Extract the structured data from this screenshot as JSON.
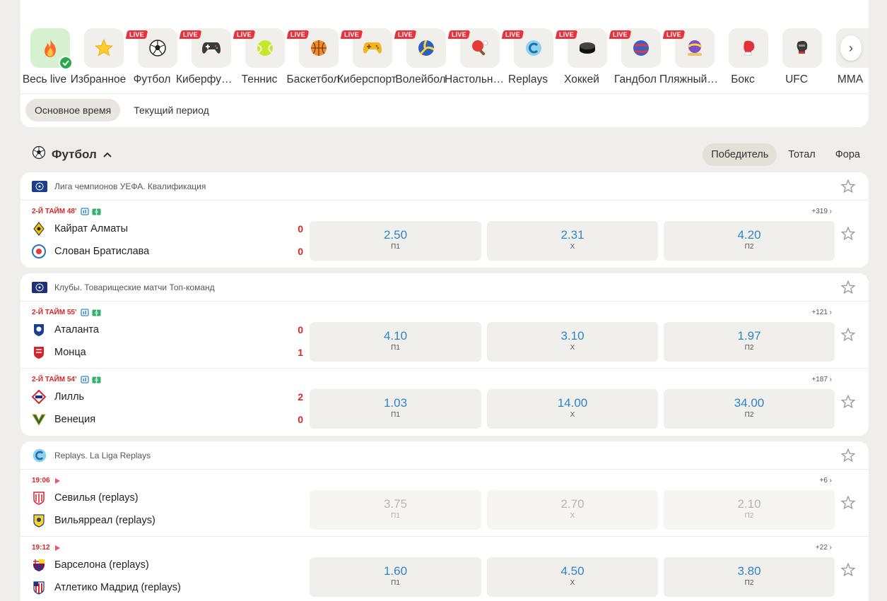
{
  "sports": [
    {
      "label": "Весь live",
      "icon": "fire-icon",
      "live": false,
      "active": true
    },
    {
      "label": "Избранное",
      "icon": "star-icon",
      "live": false
    },
    {
      "label": "Футбол",
      "icon": "soccer-ball-icon",
      "live": true
    },
    {
      "label": "Киберфутбол",
      "icon": "gamepad-icon",
      "live": true
    },
    {
      "label": "Теннис",
      "icon": "tennis-ball-icon",
      "live": true
    },
    {
      "label": "Баскетбол",
      "icon": "basketball-icon",
      "live": true
    },
    {
      "label": "Киберспорт",
      "icon": "joystick-icon",
      "live": true
    },
    {
      "label": "Волейбол",
      "icon": "volleyball-icon",
      "live": true
    },
    {
      "label": "Настольный теннис",
      "icon": "ping-pong-icon",
      "live": true
    },
    {
      "label": "Replays",
      "icon": "replays-icon",
      "live": true
    },
    {
      "label": "Хоккей",
      "icon": "hockey-puck-icon",
      "live": true
    },
    {
      "label": "Гандбол",
      "icon": "handball-icon",
      "live": true
    },
    {
      "label": "Пляжный волейбол",
      "icon": "beach-volleyball-icon",
      "live": true
    },
    {
      "label": "Бокс",
      "icon": "boxing-glove-icon",
      "live": false
    },
    {
      "label": "UFC",
      "icon": "mma-glove-icon",
      "live": false
    },
    {
      "label": "MMA",
      "icon": "mma-icon",
      "live": false
    }
  ],
  "live_label": "LIVE",
  "period_tabs": [
    "Основное время",
    "Текущий период"
  ],
  "section": {
    "title": "Футбол"
  },
  "market_tabs": [
    "Победитель",
    "Тотал",
    "Фора"
  ],
  "leagues": [
    {
      "name": "Лига чемпионов УЕФА. Квалификация",
      "matches": [
        {
          "time": "2-Й ТАЙМ 48'",
          "more": "+319 ›",
          "home": "Кайрат Алматы",
          "away": "Слован Братислава",
          "home_score": "0",
          "away_score": "0",
          "odds": [
            {
              "val": "2.50",
              "label": "П1"
            },
            {
              "val": "2.31",
              "label": "Х"
            },
            {
              "val": "4.20",
              "label": "П2"
            }
          ]
        }
      ]
    },
    {
      "name": "Клубы. Товарищеские матчи Топ-команд",
      "matches": [
        {
          "time": "2-Й ТАЙМ 55'",
          "more": "+121 ›",
          "home": "Аталанта",
          "away": "Монца",
          "home_score": "0",
          "away_score": "1",
          "odds": [
            {
              "val": "4.10",
              "label": "П1"
            },
            {
              "val": "3.10",
              "label": "Х"
            },
            {
              "val": "1.97",
              "label": "П2"
            }
          ]
        },
        {
          "time": "2-Й ТАЙМ 54'",
          "more": "+187 ›",
          "home": "Лилль",
          "away": "Венеция",
          "home_score": "2",
          "away_score": "0",
          "odds": [
            {
              "val": "1.03",
              "label": "П1"
            },
            {
              "val": "14.00",
              "label": "Х"
            },
            {
              "val": "34.00",
              "label": "П2"
            }
          ]
        }
      ]
    },
    {
      "name": "Replays. La Liga Replays",
      "matches": [
        {
          "time": "19:06",
          "more": "+6 ›",
          "home": "Севилья (replays)",
          "away": "Вильярреал (replays)",
          "home_score": "",
          "away_score": "",
          "odds": [
            {
              "val": "3.75",
              "label": "П1"
            },
            {
              "val": "2.70",
              "label": "Х"
            },
            {
              "val": "2.10",
              "label": "П2"
            }
          ]
        },
        {
          "time": "19:12",
          "more": "+22 ›",
          "home": "Барселона (replays)",
          "away": "Атлетико Мадрид (replays)",
          "home_score": "",
          "away_score": "",
          "odds": [
            {
              "val": "1.60",
              "label": "П1"
            },
            {
              "val": "4.50",
              "label": "Х"
            },
            {
              "val": "3.80",
              "label": "П2"
            }
          ]
        }
      ]
    }
  ]
}
